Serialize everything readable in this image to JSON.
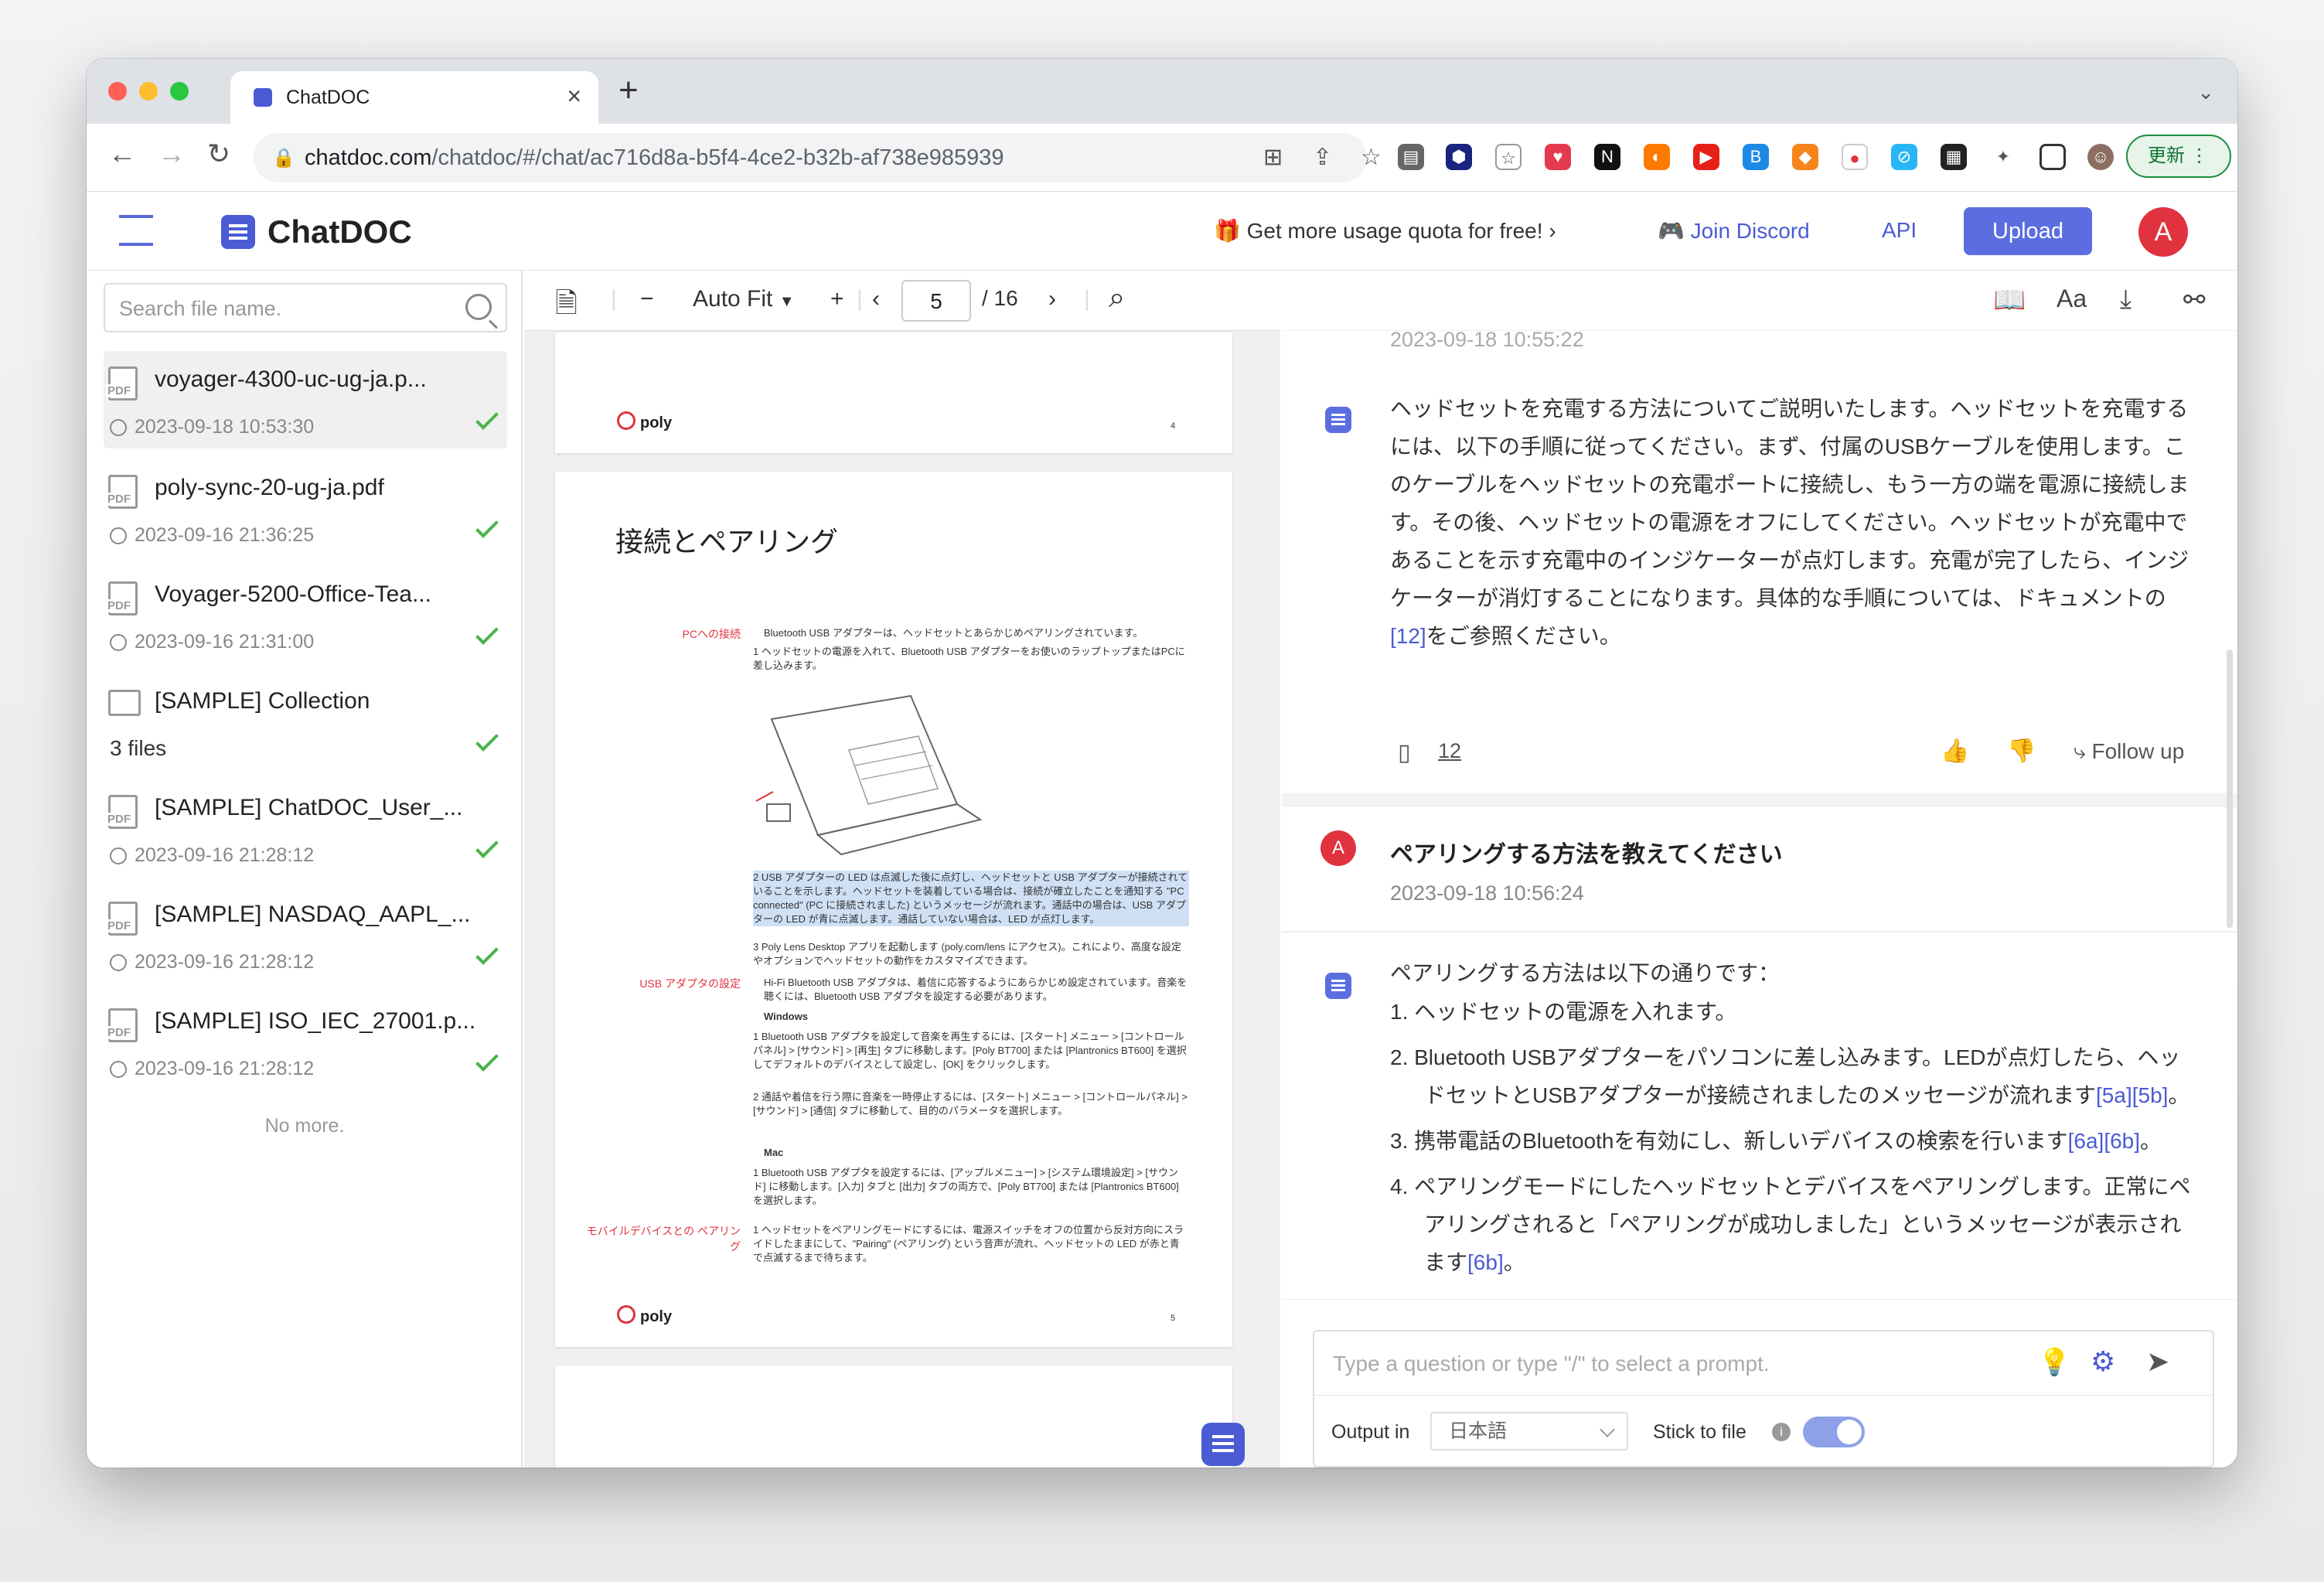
{
  "browser": {
    "tab_title": "ChatDOC",
    "url_host": "chatdoc.com",
    "url_path": "/chatdoc/#/chat/ac716d8a-b5f4-4ce2-b32b-af738e985939",
    "update_label": "更新"
  },
  "header": {
    "logo": "ChatDOC",
    "promo": "🎁 Get more usage quota for free!",
    "discord": "Join Discord",
    "api": "API",
    "upload": "Upload",
    "avatar": "A"
  },
  "sidebar": {
    "search_placeholder": "Search file name.",
    "files": [
      {
        "name": "voyager-4300-uc-ug-ja.p...",
        "date": "2023-09-18 10:53:30"
      },
      {
        "name": "poly-sync-20-ug-ja.pdf",
        "date": "2023-09-16 21:36:25"
      },
      {
        "name": "Voyager-5200-Office-Tea...",
        "date": "2023-09-16 21:31:00"
      },
      {
        "name": "[SAMPLE] Collection",
        "date": "3 files"
      },
      {
        "name": "[SAMPLE] ChatDOC_User_...",
        "date": "2023-09-16 21:28:12"
      },
      {
        "name": "[SAMPLE] NASDAQ_AAPL_...",
        "date": "2023-09-16 21:28:12"
      },
      {
        "name": "[SAMPLE] ISO_IEC_27001.p...",
        "date": "2023-09-16 21:28:12"
      }
    ],
    "no_more": "No more."
  },
  "viewer": {
    "zoom": "Auto Fit",
    "page": "5",
    "total": "/ 16",
    "page_heading": "接続とペアリング",
    "brand": "poly",
    "prev_page_num": "4",
    "page_num": "5",
    "sec_pc": "PCへの接続",
    "sec_usb": "USB アダプタの設定",
    "sec_mobile": "モバイルデバイスとの ペアリング",
    "t1": "Bluetooth USB アダプターは、ヘッドセットとあらかじめペアリングされています。",
    "t2": "1 ヘッドセットの電源を入れて、Bluetooth USB アダプターをお使いのラップトップまたはPCに差し込みます。",
    "t3": "2 USB アダプターの LED は点滅した後に点灯し、ヘッドセットと USB アダプターが接続されていることを示します。ヘッドセットを装着している場合は、接続が確立したことを通知する \"PC connected\" (PC に接続されました) というメッセージが流れます。通話中の場合は、USB アダプターの LED が青に点滅します。通話していない場合は、LED が点灯します。",
    "t4": "3 Poly Lens Desktop アプリを起動します (poly.com/lens にアクセス)。これにより、高度な設定やオプションでヘッドセットの動作をカスタマイズできます。",
    "t5": "Hi-Fi Bluetooth USB アダプタは、着信に応答するようにあらかじめ設定されています。音楽を聴くには、Bluetooth USB アダプタを設定する必要があります。",
    "t6": "Windows",
    "t7": "1 Bluetooth USB アダプタを設定して音楽を再生するには、[スタート] メニュー > [コントロールパネル] > [サウンド] > [再生] タブに移動します。[Poly BT700] または [Plantronics BT600] を選択してデフォルトのデバイスとして設定し、[OK] をクリックします。",
    "t8": "2 通話や着信を行う際に音楽を一時停止するには、[スタート] メニュー > [コントロールパネル] > [サウンド] > [通信] タブに移動して、目的のパラメータを選択します。",
    "t9": "Mac",
    "t10": "1 Bluetooth USB アダプタを設定するには、[アップルメニュー] > [システム環境設定] > [サウンド] に移動します。[入力] タブと [出力] タブの両方で、[Poly BT700] または [Plantronics BT600] を選択します。",
    "t11": "1 ヘッドセットをペアリングモードにするには、電源スイッチをオフの位置から反対方向にスライドしたままにして、\"Pairing\" (ペアリング) という音声が流れ、ヘッドセットの LED が赤と青で点滅するまで待ちます。"
  },
  "chat": {
    "prev_ts": "2023-09-18 10:55:22",
    "answer1_pre": "ヘッドセットを充電する方法についてご説明いたします。ヘッドセットを充電するには、以下の手順に従ってください。まず、付属のUSBケーブルを使用します。このケーブルをヘッドセットの充電ポートに接続し、もう一方の端を電源に接続します。その後、ヘッドセットの電源をオフにしてください。ヘッドセットが充電中であることを示す充電中のインジケーターが点灯します。充電が完了したら、インジケーターが消灯することになります。具体的な手順については、ドキュメントの",
    "answer1_ref": "[12]",
    "answer1_post": "をご参照ください。",
    "source_ref": "12",
    "follow_up": "Follow up",
    "user_avatar": "A",
    "question": "ペアリングする方法を教えてください",
    "question_ts": "2023-09-18 10:56:24",
    "answer2_intro": "ペアリングする方法は以下の通りです：",
    "steps": [
      {
        "pre": "1. ヘッドセットの電源を入れます。",
        "refs": "",
        "post": ""
      },
      {
        "pre": "2. Bluetooth USBアダプターをパソコンに差し込みます。LEDが点灯したら、ヘッドセットとUSBアダプターが接続されましたのメッセージが流れます",
        "refs": "[5a][5b]",
        "post": "。"
      },
      {
        "pre": "3. 携帯電話のBluetoothを有効にし、新しいデバイスの検索を行います",
        "refs": "[6a][6b]",
        "post": "。"
      },
      {
        "pre": "4. ペアリングモードにしたヘッドセットとデバイスをペアリングします。正常にペアリングされると「ペアリングが成功しました」というメッセージが表示されます",
        "refs": "[6b]",
        "post": "。"
      }
    ],
    "prompt_placeholder": "Type a question or type \"/\" to select a prompt.",
    "output_label": "Output in",
    "output_lang": "日本語",
    "stick_label": "Stick to file",
    "info": "i"
  }
}
